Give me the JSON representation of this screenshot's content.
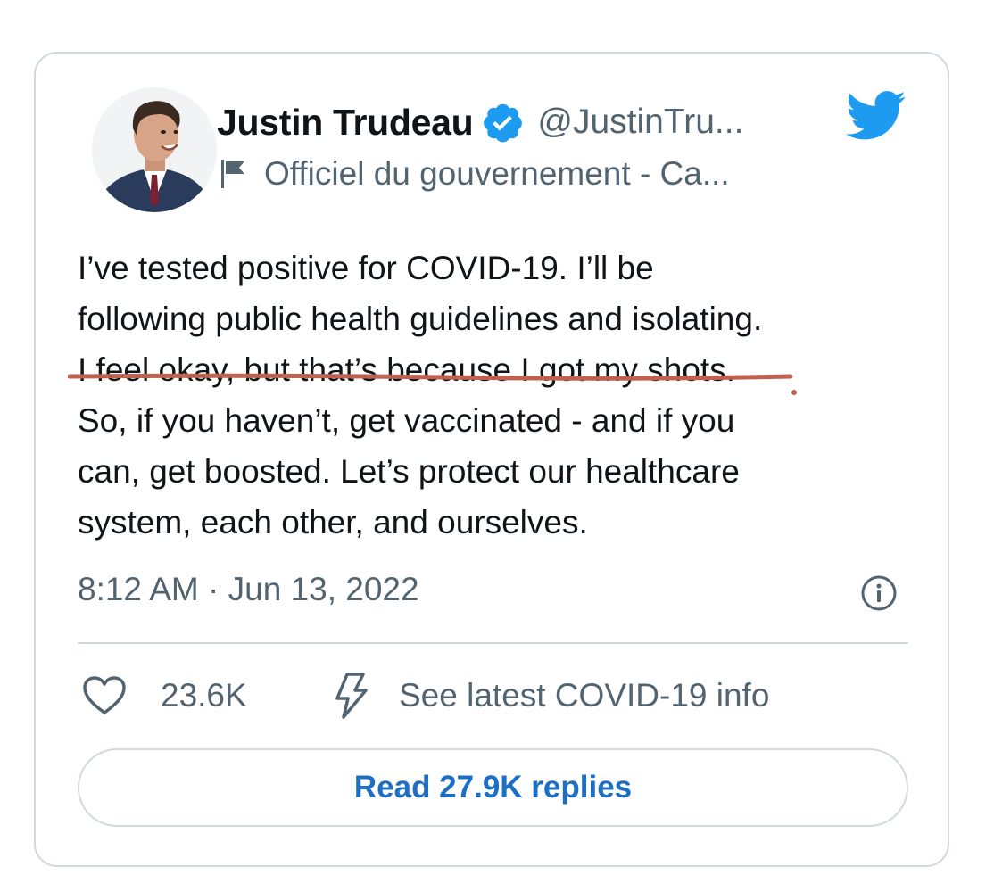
{
  "tweet": {
    "author": {
      "display_name": "Justin Trudeau",
      "handle": "@JustinTru...",
      "label": "Officiel du gouvernement - Ca...",
      "verified": true
    },
    "text": "I’ve tested positive for COVID-19. I’ll be\nfollowing public health guidelines and isolating.\nI feel okay, but that’s because I got my shots.\nSo, if you haven’t, get vaccinated - and if you\ncan, get boosted. Let’s protect our healthcare\nsystem, each other, and ourselves.",
    "timestamp": "8:12 AM · Jun 13, 2022",
    "likes": "23.6K",
    "covid_link": "See latest COVID-19 info",
    "replies_button": "Read 27.9K replies"
  },
  "icons": {
    "brand_logo": "twitter-bird-icon",
    "verified": "verified-badge-icon",
    "gov_label": "flag-icon",
    "info": "info-icon",
    "like": "heart-icon",
    "covid": "lightning-bolt-icon"
  },
  "colors": {
    "twitter_blue": "#1d9bf0",
    "link_blue": "#1d6fc4",
    "secondary_text": "#536471",
    "border": "#cfd9de",
    "annotation_red": "#c0604f"
  }
}
